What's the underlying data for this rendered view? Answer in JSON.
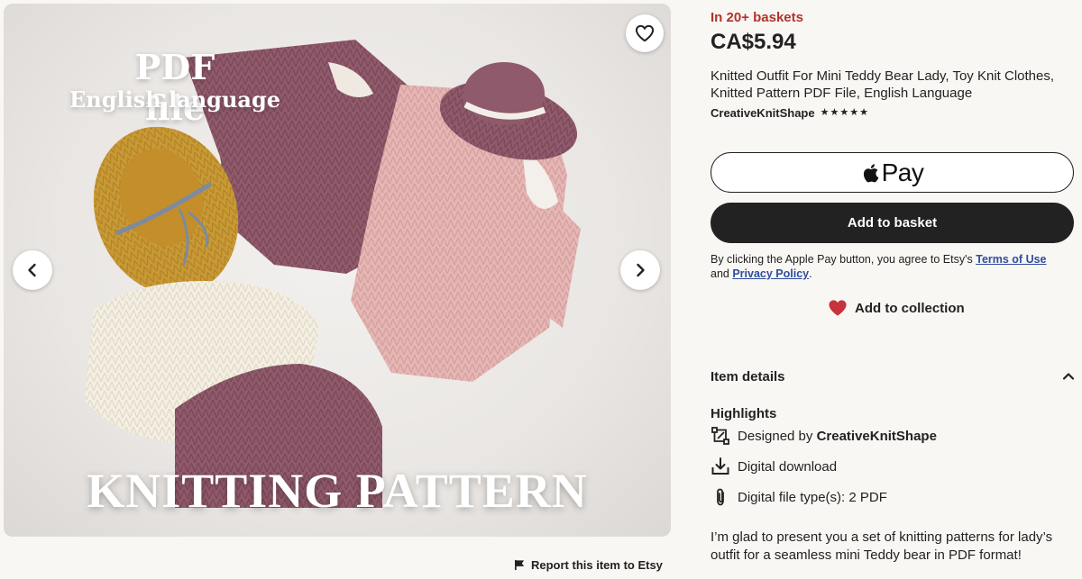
{
  "gallery": {
    "overlay_title": "PDF file",
    "overlay_subtitle": "English language",
    "overlay_bottom": "KNITTING PATTERN"
  },
  "report": {
    "label": "Report this item to Etsy"
  },
  "listing": {
    "baskets_badge": "In 20+ baskets",
    "price": "CA$5.94",
    "title": "Knitted Outfit For Mini Teddy Bear Lady, Toy Knit Clothes, Knitted Pattern PDF File, English Language",
    "shop_name": "CreativeKnitShape",
    "rating_stars": 5
  },
  "buttons": {
    "apple_pay_label": "Pay",
    "add_to_basket": "Add to basket",
    "add_to_collection": "Add to collection"
  },
  "legal": {
    "prefix": "By clicking the Apple Pay button, you agree to Etsy's ",
    "terms_link": "Terms of Use",
    "middle": "and ",
    "privacy_link": "Privacy Policy",
    "suffix": "."
  },
  "details": {
    "label": "Item details",
    "highlights_title": "Highlights",
    "designed_by_prefix": "Designed by ",
    "designed_by_shop": "CreativeKnitShape",
    "digital_download": "Digital download",
    "file_types": "Digital file type(s): 2 PDF",
    "description": "I’m glad to present you a set of knitting patterns for lady’s outfit for a seamless mini Teddy bear in PDF format!"
  },
  "colors": {
    "badge_red": "#b1332b",
    "link_blue": "#2f4d9e",
    "heart_red": "#c8323b",
    "button_dark": "#222222",
    "background": "#f9f7f4"
  }
}
